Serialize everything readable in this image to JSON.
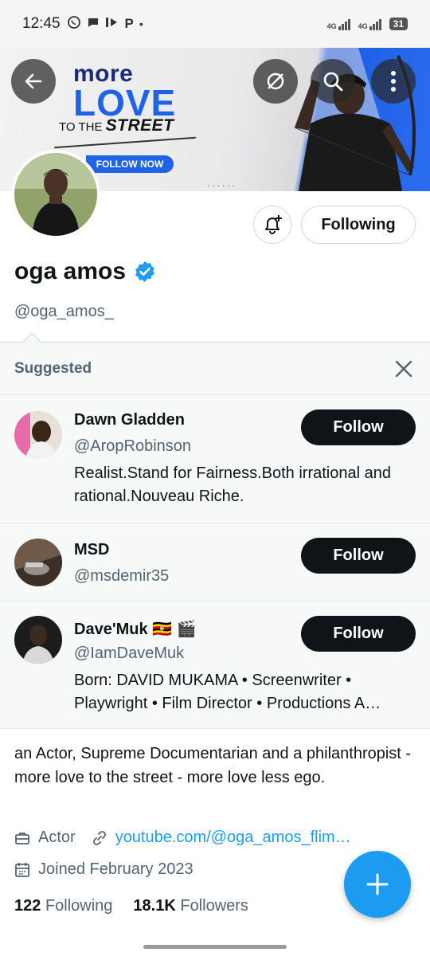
{
  "status_bar": {
    "time": "12:45",
    "network_1": "4G",
    "network_2": "4G",
    "battery": "31"
  },
  "banner": {
    "line1": "more",
    "line2": "LOVE",
    "line3_prefix": "TO THE",
    "line3_bold": "STREET",
    "cta": "FOLLOW NOW",
    "dots": "......",
    "accent_color": "#1f64e6"
  },
  "profile": {
    "following_button": "Following",
    "name": "oga amos",
    "handle": "@oga_amos_",
    "verified": true,
    "bio": "an Actor, Supreme Documentarian and a philanthropist - more love to the street - more love less ego.",
    "category": "Actor",
    "website": "youtube.com/@oga_amos_flim…",
    "joined": "Joined February 2023",
    "following_count": "122",
    "following_label": "Following",
    "followers_count": "18.1K",
    "followers_label": "Followers"
  },
  "suggested": {
    "title": "Suggested",
    "items": [
      {
        "name": "Dawn Gladden",
        "handle": "@AropRobinson",
        "bio": "Realist.Stand for Fairness.Both irrational and rational.Nouveau Riche.",
        "button": "Follow"
      },
      {
        "name": "MSD",
        "handle": "@msdemir35",
        "bio": "",
        "button": "Follow"
      },
      {
        "name": "Dave'Muk 🇺🇬 🎬",
        "handle": "@IamDaveMuk",
        "bio": "Born: DAVID MUKAMA •  Screenwriter • Playwright • Film Director • Productions A…",
        "button": "Follow"
      }
    ]
  },
  "colors": {
    "link": "#1d9bf0",
    "follow_button_bg": "#0f1419",
    "secondary_text": "#536471",
    "fab": "#1d9bf0"
  }
}
